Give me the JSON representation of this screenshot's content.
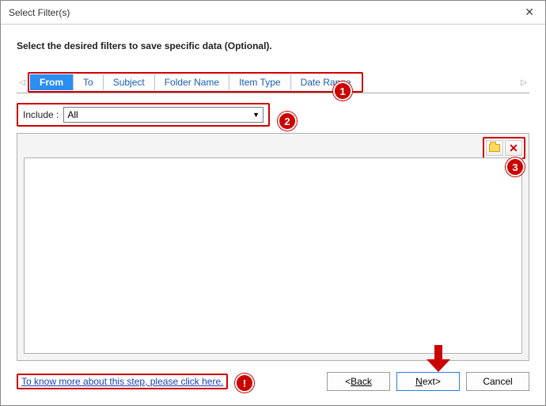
{
  "window": {
    "title": "Select Filter(s)",
    "close_label": "✕"
  },
  "instruction": "Select the desired filters to save specific data (Optional).",
  "tabs": {
    "items": [
      {
        "label": "From",
        "active": true
      },
      {
        "label": "To",
        "active": false
      },
      {
        "label": "Subject",
        "active": false
      },
      {
        "label": "Folder Name",
        "active": false
      },
      {
        "label": "Item Type",
        "active": false
      },
      {
        "label": "Date Range",
        "active": false
      }
    ],
    "scroll_left": "◁",
    "scroll_right": "▷"
  },
  "include": {
    "label": "Include :",
    "value": "All"
  },
  "toolbar": {
    "browse_name": "browse-folder",
    "remove_name": "remove"
  },
  "help": {
    "text": "To know more about this step, please click here."
  },
  "buttons": {
    "back": "Back",
    "next": "Next",
    "cancel": "Cancel"
  },
  "annotations": {
    "b1": "1",
    "b2": "2",
    "b3": "3",
    "bhelp": "!"
  }
}
